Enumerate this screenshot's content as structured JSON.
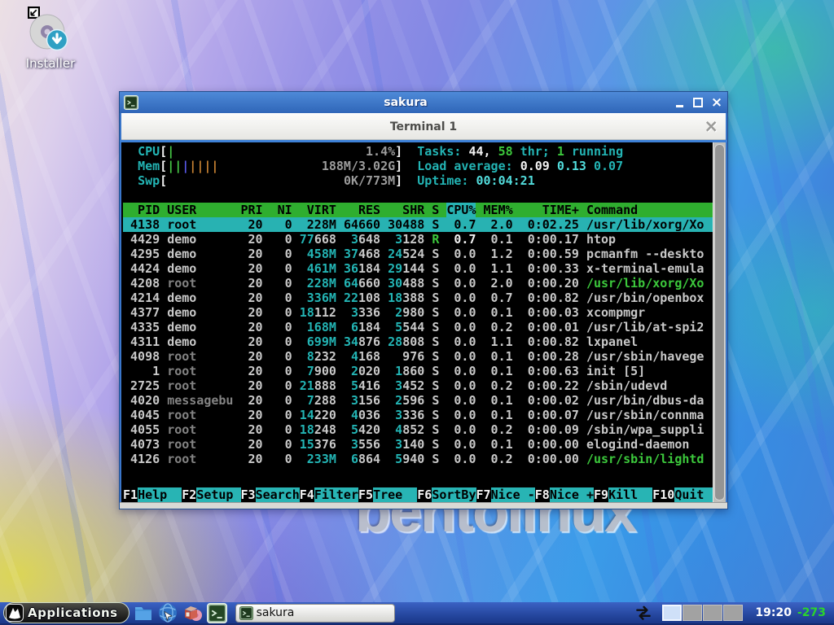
{
  "desktop": {
    "installer_label": "Installer",
    "watermark": "bentolinux"
  },
  "window": {
    "title": "sakura",
    "tab_label": "Terminal 1"
  },
  "icons": {
    "window_close": "×",
    "tab_close": "×"
  },
  "htop": {
    "meters": [
      {
        "name": "cpu",
        "label": "CPU",
        "value": "1.4%",
        "bars": [
          "green"
        ]
      },
      {
        "name": "mem",
        "label": "Mem",
        "value": "188M/3.02G",
        "bars": [
          "green",
          "green",
          "blue",
          "orange",
          "orange",
          "orange",
          "orange"
        ]
      },
      {
        "name": "swp",
        "label": "Swp",
        "value": "0K/773M",
        "bars": []
      }
    ],
    "info": [
      [
        [
          "Tasks: ",
          "cyan"
        ],
        [
          "44, ",
          "bwhite"
        ],
        [
          "58",
          "green"
        ],
        [
          " thr; ",
          "cyan"
        ],
        [
          "1",
          "green"
        ],
        [
          " running",
          "cyan"
        ]
      ],
      [
        [
          "Load average: ",
          "cyan"
        ],
        [
          "0.09 ",
          "bwhite"
        ],
        [
          "0.13 ",
          "bcyan"
        ],
        [
          "0.07",
          "cyan"
        ]
      ],
      [
        [
          "Uptime: ",
          "cyan"
        ],
        [
          "00:04:21",
          "bcyan"
        ]
      ]
    ],
    "table": {
      "columns": [
        "PID",
        "USER",
        "PRI",
        "NI",
        "VIRT",
        "RES",
        "SHR",
        "S",
        "CPU%",
        "MEM%",
        "TIME+",
        "Command"
      ],
      "sort_column": "CPU%",
      "rows": [
        {
          "pid": "4138",
          "user": "root",
          "pri": "20",
          "ni": "0",
          "virt": "228M",
          "res": "64660",
          "shr": "30488",
          "s": "S",
          "cpu": "0.7",
          "mem": "2.0",
          "time": "0:02.25",
          "cmd": "/usr/lib/xorg/Xo",
          "selected": true
        },
        {
          "pid": "4429",
          "user": "demo",
          "pri": "20",
          "ni": "0",
          "virt": "77668",
          "res": "3648",
          "shr": "3128",
          "s": "R",
          "cpu": "0.7",
          "mem": "0.1",
          "time": "0:00.17",
          "cmd": "htop"
        },
        {
          "pid": "4295",
          "user": "demo",
          "pri": "20",
          "ni": "0",
          "virt": "458M",
          "res": "37468",
          "shr": "24524",
          "s": "S",
          "cpu": "0.0",
          "mem": "1.2",
          "time": "0:00.59",
          "cmd": "pcmanfm --deskto"
        },
        {
          "pid": "4424",
          "user": "demo",
          "pri": "20",
          "ni": "0",
          "virt": "461M",
          "res": "36184",
          "shr": "29144",
          "s": "S",
          "cpu": "0.0",
          "mem": "1.1",
          "time": "0:00.33",
          "cmd": "x-terminal-emula"
        },
        {
          "pid": "4208",
          "user": "root",
          "dim": true,
          "pri": "20",
          "ni": "0",
          "virt": "228M",
          "res": "64660",
          "shr": "30488",
          "s": "S",
          "cpu": "0.0",
          "mem": "2.0",
          "time": "0:00.20",
          "cmd": "/usr/lib/xorg/Xo",
          "cmd_green": true
        },
        {
          "pid": "4214",
          "user": "demo",
          "pri": "20",
          "ni": "0",
          "virt": "336M",
          "res": "22108",
          "shr": "18388",
          "s": "S",
          "cpu": "0.0",
          "mem": "0.7",
          "time": "0:00.82",
          "cmd": "/usr/bin/openbox"
        },
        {
          "pid": "4377",
          "user": "demo",
          "pri": "20",
          "ni": "0",
          "virt": "18112",
          "res": "3336",
          "shr": "2980",
          "s": "S",
          "cpu": "0.0",
          "mem": "0.1",
          "time": "0:00.03",
          "cmd": "xcompmgr"
        },
        {
          "pid": "4335",
          "user": "demo",
          "pri": "20",
          "ni": "0",
          "virt": "168M",
          "res": "6184",
          "shr": "5544",
          "s": "S",
          "cpu": "0.0",
          "mem": "0.2",
          "time": "0:00.01",
          "cmd": "/usr/lib/at-spi2"
        },
        {
          "pid": "4311",
          "user": "demo",
          "pri": "20",
          "ni": "0",
          "virt": "699M",
          "res": "34876",
          "shr": "28808",
          "s": "S",
          "cpu": "0.0",
          "mem": "1.1",
          "time": "0:00.82",
          "cmd": "lxpanel"
        },
        {
          "pid": "4098",
          "user": "root",
          "dim": true,
          "pri": "20",
          "ni": "0",
          "virt": "8232",
          "res": "4168",
          "shr": "976",
          "s": "S",
          "cpu": "0.0",
          "mem": "0.1",
          "time": "0:00.28",
          "cmd": "/usr/sbin/havege"
        },
        {
          "pid": "1",
          "user": "root",
          "dim": true,
          "pri": "20",
          "ni": "0",
          "virt": "7900",
          "res": "2020",
          "shr": "1860",
          "s": "S",
          "cpu": "0.0",
          "mem": "0.1",
          "time": "0:00.63",
          "cmd": "init [5]"
        },
        {
          "pid": "2725",
          "user": "root",
          "dim": true,
          "pri": "20",
          "ni": "0",
          "virt": "21888",
          "res": "5416",
          "shr": "3452",
          "s": "S",
          "cpu": "0.0",
          "mem": "0.2",
          "time": "0:00.22",
          "cmd": "/sbin/udevd"
        },
        {
          "pid": "4020",
          "user": "messagebu",
          "dim": true,
          "pri": "20",
          "ni": "0",
          "virt": "7288",
          "res": "3156",
          "shr": "2596",
          "s": "S",
          "cpu": "0.0",
          "mem": "0.1",
          "time": "0:00.02",
          "cmd": "/usr/bin/dbus-da"
        },
        {
          "pid": "4045",
          "user": "root",
          "dim": true,
          "pri": "20",
          "ni": "0",
          "virt": "14220",
          "res": "4036",
          "shr": "3336",
          "s": "S",
          "cpu": "0.0",
          "mem": "0.1",
          "time": "0:00.07",
          "cmd": "/usr/sbin/connma"
        },
        {
          "pid": "4055",
          "user": "root",
          "dim": true,
          "pri": "20",
          "ni": "0",
          "virt": "18248",
          "res": "5420",
          "shr": "4852",
          "s": "S",
          "cpu": "0.0",
          "mem": "0.2",
          "time": "0:00.09",
          "cmd": "/sbin/wpa_suppli"
        },
        {
          "pid": "4073",
          "user": "root",
          "dim": true,
          "pri": "20",
          "ni": "0",
          "virt": "15376",
          "res": "3556",
          "shr": "3140",
          "s": "S",
          "cpu": "0.0",
          "mem": "0.1",
          "time": "0:00.00",
          "cmd": "elogind-daemon"
        },
        {
          "pid": "4126",
          "user": "root",
          "dim": true,
          "pri": "20",
          "ni": "0",
          "virt": "233M",
          "res": "6864",
          "shr": "5940",
          "s": "S",
          "cpu": "0.0",
          "mem": "0.2",
          "time": "0:00.00",
          "cmd": "/usr/sbin/lightd",
          "cmd_green": true
        }
      ]
    },
    "fkeys": [
      [
        "F1",
        "Help"
      ],
      [
        "F2",
        "Setup"
      ],
      [
        "F3",
        "Search"
      ],
      [
        "F4",
        "Filter"
      ],
      [
        "F5",
        "Tree"
      ],
      [
        "F6",
        "SortBy"
      ],
      [
        "F7",
        "Nice -"
      ],
      [
        "F8",
        "Nice +"
      ],
      [
        "F9",
        "Kill"
      ],
      [
        "F10",
        "Quit"
      ]
    ]
  },
  "taskbar": {
    "applications_label": "Applications",
    "task_button_label": "sakura",
    "workspace_count": 4,
    "active_workspace": 0,
    "clock": "19:20",
    "temperature": "-273"
  }
}
